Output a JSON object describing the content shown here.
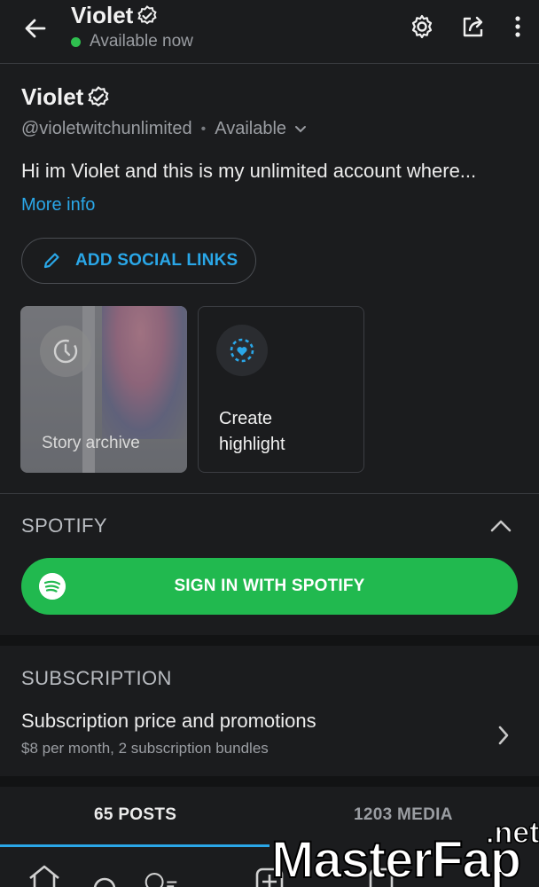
{
  "header": {
    "name": "Violet",
    "status": "Available now"
  },
  "profile": {
    "name": "Violet",
    "handle": "@violetwitchunlimited",
    "separator": "•",
    "availability": "Available",
    "bio": "Hi im Violet and this is my unlimited account where...",
    "more_info": "More info",
    "add_social_links": "ADD SOCIAL LINKS"
  },
  "highlights": {
    "archive_label": "Story archive",
    "create_label": "Create highlight"
  },
  "spotify": {
    "title": "SPOTIFY",
    "button": "SIGN IN WITH SPOTIFY"
  },
  "subscription": {
    "title": "SUBSCRIPTION",
    "row_title": "Subscription price and promotions",
    "row_subtitle": "$8 per month, 2 subscription bundles"
  },
  "tabs": {
    "posts": "65 POSTS",
    "media": "1203 MEDIA"
  },
  "watermark": {
    "main": "MasterFap",
    "suffix": ".net"
  },
  "colors": {
    "accent": "#2aa7e8",
    "spotify_green": "#21b94f",
    "online_green": "#2fbf4f",
    "background": "#1b1c1e"
  },
  "icons": [
    "back-arrow-icon",
    "verified-badge-icon",
    "gear-icon",
    "share-icon",
    "more-vertical-icon",
    "chevron-down-icon",
    "pencil-icon",
    "clock-history-icon",
    "highlight-heart-icon",
    "chevron-up-icon",
    "spotify-icon",
    "chevron-right-icon",
    "home-icon",
    "search-icon",
    "plus-icon",
    "messages-icon"
  ]
}
